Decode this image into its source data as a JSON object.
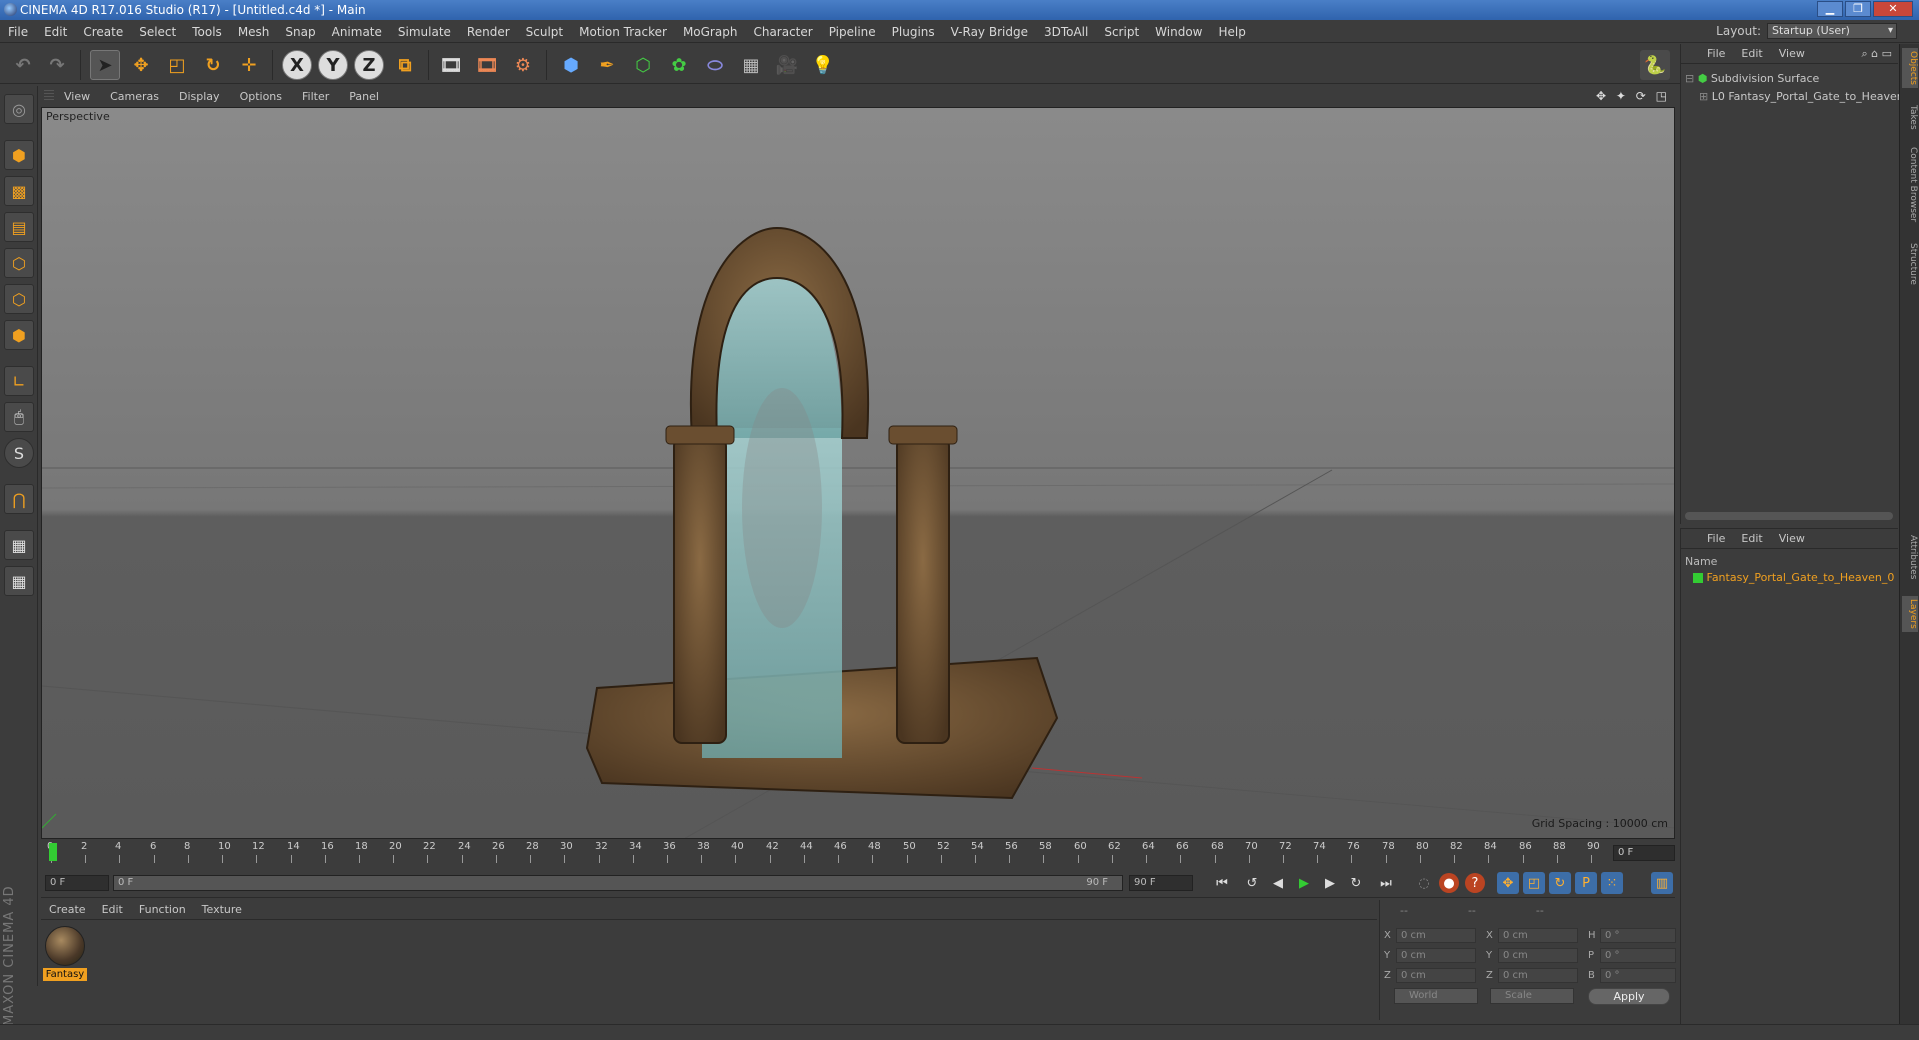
{
  "window": {
    "title": "CINEMA 4D R17.016 Studio (R17) - [Untitled.c4d *] - Main"
  },
  "menu": [
    "File",
    "Edit",
    "Create",
    "Select",
    "Tools",
    "Mesh",
    "Snap",
    "Animate",
    "Simulate",
    "Render",
    "Sculpt",
    "Motion Tracker",
    "MoGraph",
    "Character",
    "Pipeline",
    "Plugins",
    "V-Ray Bridge",
    "3DToAll",
    "Script",
    "Window",
    "Help"
  ],
  "layout": {
    "label": "Layout:",
    "value": "Startup (User)"
  },
  "toolbar": {
    "x_label": "X",
    "y_label": "Y",
    "z_label": "Z"
  },
  "viewport": {
    "menu": [
      "View",
      "Cameras",
      "Display",
      "Options",
      "Filter",
      "Panel"
    ],
    "label": "Perspective",
    "grid_spacing": "Grid Spacing : 10000 cm"
  },
  "timeline": {
    "ticks": [
      "0",
      "2",
      "4",
      "6",
      "8",
      "10",
      "12",
      "14",
      "16",
      "18",
      "20",
      "22",
      "24",
      "26",
      "28",
      "30",
      "32",
      "34",
      "36",
      "38",
      "40",
      "42",
      "44",
      "46",
      "48",
      "50",
      "52",
      "54",
      "56",
      "58",
      "60",
      "62",
      "64",
      "66",
      "68",
      "70",
      "72",
      "74",
      "76",
      "78",
      "80",
      "82",
      "84",
      "86",
      "88",
      "90"
    ],
    "current": "0 F",
    "start": "0 F",
    "range_start": "0 F",
    "range_end": "90 F",
    "end": "90 F"
  },
  "materials": {
    "menu": [
      "Create",
      "Edit",
      "Function",
      "Texture"
    ],
    "items": [
      {
        "label": "Fantasy"
      }
    ]
  },
  "coords": {
    "headers": [
      "--",
      "--",
      "--"
    ],
    "rows": [
      {
        "a1": "X",
        "v1": "0 cm",
        "a2": "X",
        "v2": "0 cm",
        "a3": "H",
        "v3": "0 °"
      },
      {
        "a1": "Y",
        "v1": "0 cm",
        "a2": "Y",
        "v2": "0 cm",
        "a3": "P",
        "v3": "0 °"
      },
      {
        "a1": "Z",
        "v1": "0 cm",
        "a2": "Z",
        "v2": "0 cm",
        "a3": "B",
        "v3": "0 °"
      }
    ],
    "space": "World",
    "mode": "Scale",
    "apply": "Apply"
  },
  "objects": {
    "menu": [
      "File",
      "Edit",
      "View"
    ],
    "items": [
      "Subdivision Surface",
      "Fantasy_Portal_Gate_to_Heaven_"
    ]
  },
  "layers": {
    "menu": [
      "File",
      "Edit",
      "View"
    ],
    "column": "Name",
    "items": [
      "Fantasy_Portal_Gate_to_Heaven_0"
    ]
  },
  "right_tabs": [
    "Objects",
    "Takes",
    "Content Browser",
    "Structure",
    "Attributes",
    "Layers"
  ],
  "brand": "MAXON CINEMA 4D",
  "colors": {
    "accent": "#f0a020",
    "layer_green": "#3c3"
  }
}
